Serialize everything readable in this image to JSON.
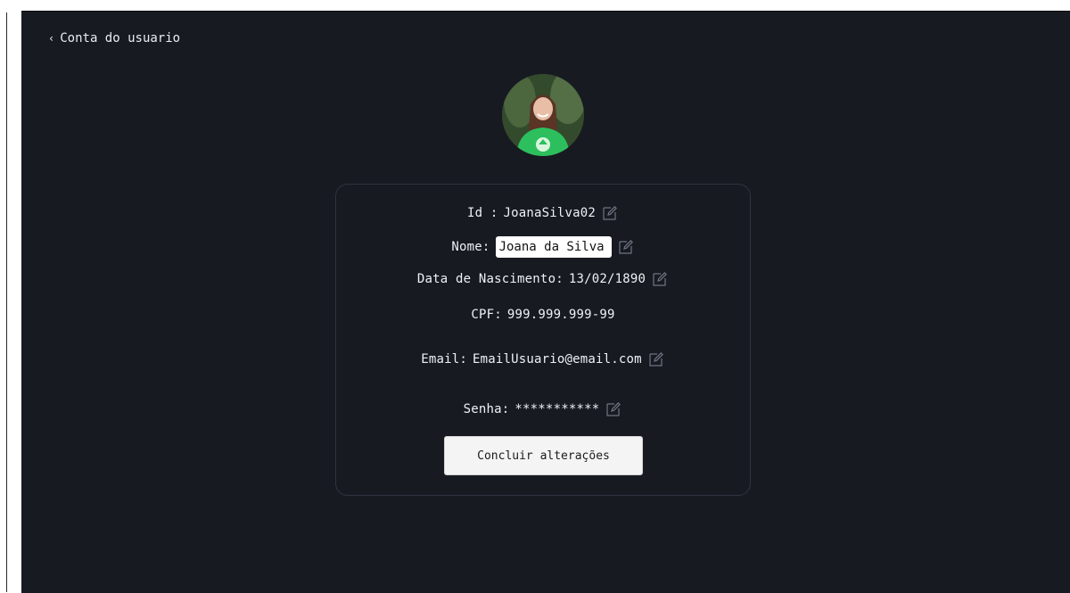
{
  "header": {
    "back_icon": "chevron-left-icon",
    "title": "Conta do usuario"
  },
  "profile": {
    "avatar_alt": "user-photo"
  },
  "fields": {
    "id": {
      "label": "Id :",
      "value": "JoanaSilva02",
      "editable": true
    },
    "nome": {
      "label": "Nome:",
      "value": "Joana da Silva",
      "editable": true
    },
    "nascimento": {
      "label": "Data de Nascimento:",
      "value": "13/02/1890",
      "editable": true
    },
    "cpf": {
      "label": "CPF:",
      "value": "999.999.999-99",
      "editable": false
    },
    "email": {
      "label": "Email:",
      "value": "EmailUsuario@email.com",
      "editable": true
    },
    "senha": {
      "label": "Senha:",
      "value": "***********",
      "editable": true
    }
  },
  "actions": {
    "submit_label": "Concluir alterações"
  },
  "colors": {
    "background": "#171a21",
    "card_border": "#2f3441",
    "text": "#eef1f5",
    "button_bg": "#f4f4f4"
  }
}
